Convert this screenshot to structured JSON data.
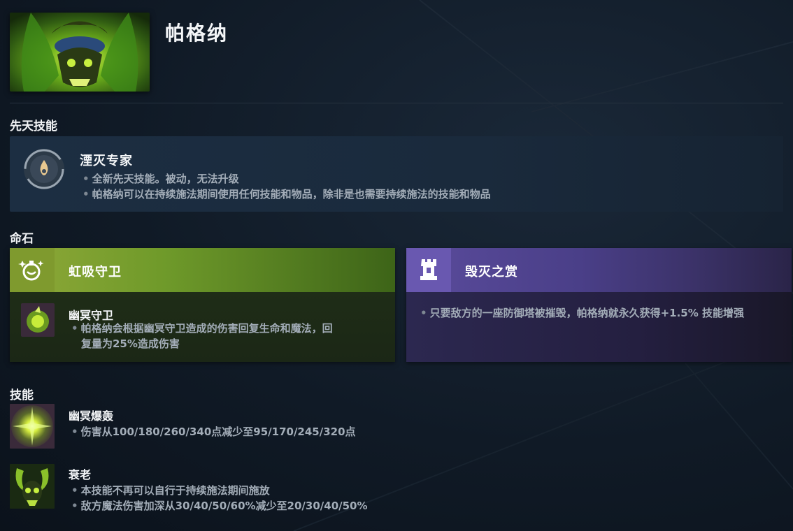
{
  "hero": {
    "name": "帕格纳",
    "portrait_icon": "pugna-portrait"
  },
  "innate": {
    "section_title": "先天技能",
    "icon": "flame-ring-icon",
    "name": "湮灭专家",
    "bullets": [
      "全新先天技能。被动，无法升级",
      "帕格纳可以在持续施法期间使用任何技能和物品，除非是也需要持续施法的技能和物品"
    ]
  },
  "shards": {
    "section_title": "命石",
    "left": {
      "badge_icon": "potion-face-icon",
      "title": "虹吸守卫",
      "sub_icon": "nether-ward-icon",
      "sub_name": "幽冥守卫",
      "bullets": [
        "帕格纳会根据幽冥守卫造成的伤害回复生命和魔法，回",
        "复量为25%造成伤害"
      ],
      "color": "#8fa838"
    },
    "right": {
      "badge_icon": "tower-icon",
      "title": "毁灭之赏",
      "bullets": [
        "只要敌方的一座防御塔被摧毁，帕格纳就永久获得+1.5% 技能增强"
      ],
      "color": "#5a4b9c"
    }
  },
  "abilities": {
    "section_title": "技能",
    "items": [
      {
        "icon": "nether-blast-icon",
        "name": "幽冥爆轰",
        "bullets": [
          "伤害从100/180/260/340点减少至95/170/245/320点"
        ]
      },
      {
        "icon": "decrepify-icon",
        "name": "衰老",
        "bullets": [
          "本技能不再可以自行于持续施法期间施放",
          "敌方魔法伤害加深从30/40/50/60%减少至20/30/40/50%"
        ]
      }
    ]
  }
}
